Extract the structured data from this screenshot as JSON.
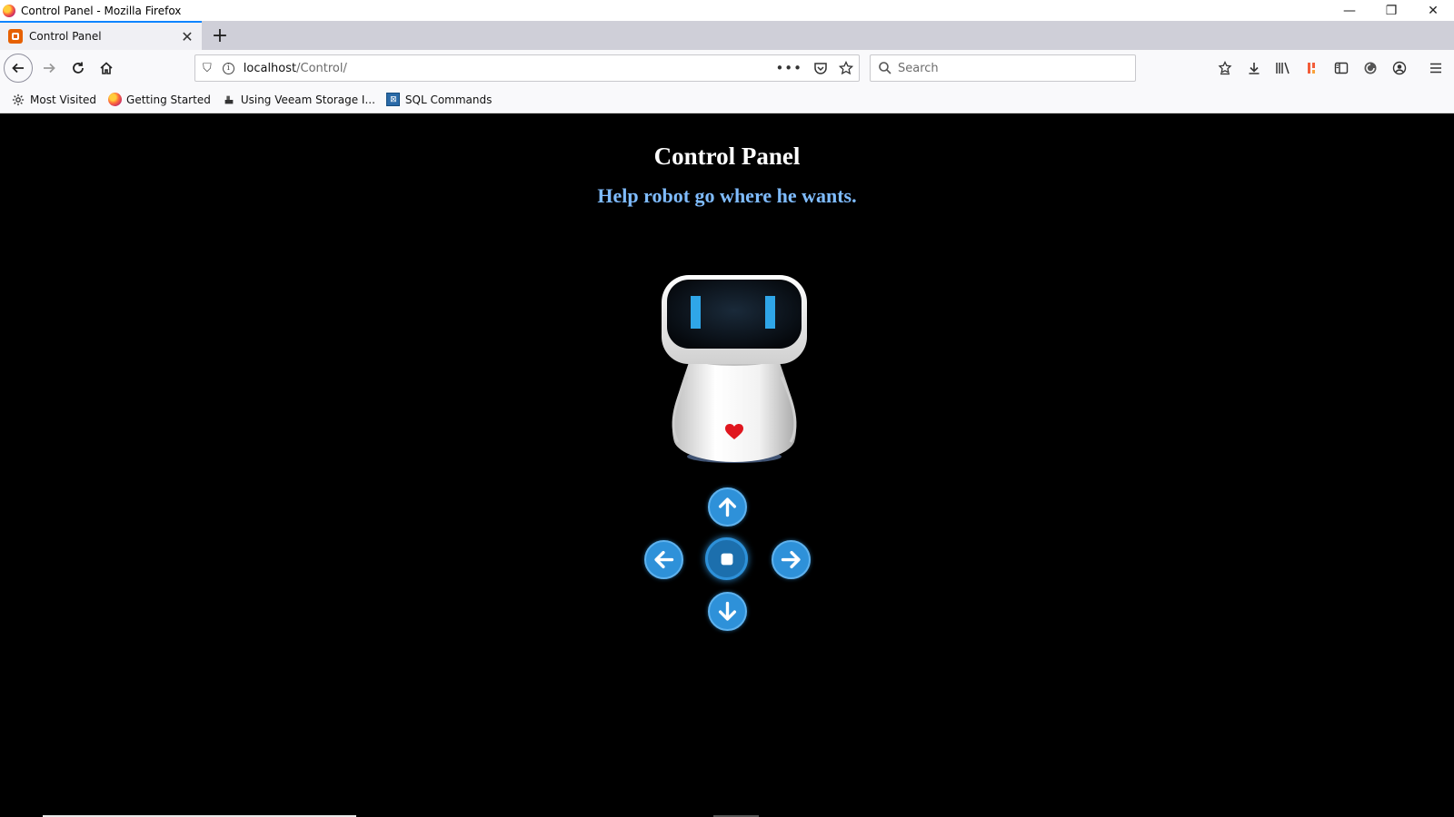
{
  "window": {
    "title": "Control Panel - Mozilla Firefox",
    "minimize_glyph": "—",
    "restore_glyph": "❐",
    "close_glyph": "✕"
  },
  "tabs": [
    {
      "title": "Control Panel",
      "close_glyph": "✕"
    }
  ],
  "new_tab_glyph": "+",
  "nav": {
    "url_host": "localhost",
    "url_path": "/Control/",
    "search_placeholder": "Search"
  },
  "bookmarks": [
    {
      "label": "Most Visited",
      "icon": "gear-icon"
    },
    {
      "label": "Getting Started",
      "icon": "firefox-icon"
    },
    {
      "label": "Using Veeam Storage I...",
      "icon": "veeam-icon"
    },
    {
      "label": "SQL Commands",
      "icon": "sql-icon"
    }
  ],
  "page": {
    "heading": "Control Panel",
    "subheading": "Help robot go where he wants."
  },
  "controls": {
    "up": "up-arrow-icon",
    "left": "left-arrow-icon",
    "stop": "stop-icon",
    "right": "right-arrow-icon",
    "down": "down-arrow-icon"
  },
  "colors": {
    "background": "#000000",
    "heading": "#ffffff",
    "subheading": "#7fbcff",
    "control_button": "#2e91d9",
    "robot_eyes": "#2fa6e8",
    "robot_heart": "#e0161e"
  }
}
